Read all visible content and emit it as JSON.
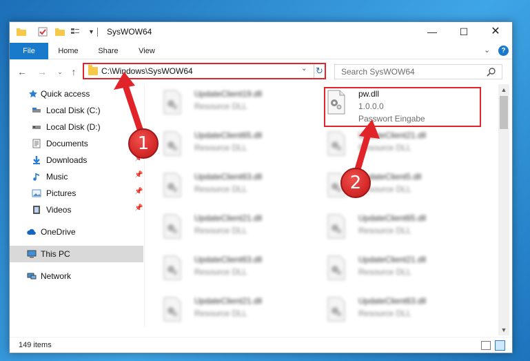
{
  "window": {
    "title": "SysWOW64"
  },
  "ribbon": {
    "tabs": [
      {
        "label": "File"
      },
      {
        "label": "Home"
      },
      {
        "label": "Share"
      },
      {
        "label": "View"
      }
    ]
  },
  "address_bar": {
    "path": "C:\\Windows\\SysWOW64"
  },
  "search": {
    "placeholder": "Search SysWOW64"
  },
  "nav_pane": {
    "items": [
      {
        "label": "Quick access",
        "icon": "star-icon"
      },
      {
        "label": "Local Disk (C:)",
        "icon": "drive-icon"
      },
      {
        "label": "Local Disk (D:)",
        "icon": "drive-icon"
      },
      {
        "label": "Documents",
        "icon": "documents-icon"
      },
      {
        "label": "Downloads",
        "icon": "download-icon"
      },
      {
        "label": "Music",
        "icon": "music-icon"
      },
      {
        "label": "Pictures",
        "icon": "pictures-icon"
      },
      {
        "label": "Videos",
        "icon": "videos-icon"
      },
      {
        "label": "OneDrive",
        "icon": "cloud-icon"
      },
      {
        "label": "This PC",
        "icon": "computer-icon"
      },
      {
        "label": "Network",
        "icon": "network-icon"
      }
    ]
  },
  "files": {
    "highlighted": {
      "name": "pw.dll",
      "version": "1.0.0.0",
      "description": "Passwort Eingabe"
    },
    "left_column": [
      {
        "name": "UpdateClient19.dll",
        "type": "Resource DLL"
      },
      {
        "name": "UpdateClient65.dll",
        "type": "Resource DLL"
      },
      {
        "name": "UpdateClient63.dll",
        "type": "Resource DLL"
      },
      {
        "name": "UpdateClient21.dll",
        "type": "Resource DLL"
      },
      {
        "name": "UpdateClient63.dll",
        "type": "Resource DLL"
      },
      {
        "name": "UpdateClient21.dll",
        "type": "Resource DLL"
      }
    ],
    "right_column": [
      {
        "name": "UpdateClient21.dll",
        "type": "Resource DLL"
      },
      {
        "name": "UpdateClient5.dll",
        "type": "Resource DLL"
      },
      {
        "name": "UpdateClient65.dll",
        "type": "Resource DLL"
      },
      {
        "name": "UpdateClient21.dll",
        "type": "Resource DLL"
      },
      {
        "name": "UpdateClient63.dll",
        "type": "Resource DLL"
      }
    ]
  },
  "status_bar": {
    "item_count": "149 items"
  },
  "annotations": {
    "step1": "1",
    "step2": "2",
    "color": "#e0242a"
  },
  "colors": {
    "accent": "#1979ca",
    "highlight": "#e0242a",
    "selected_bg": "#cde8ff"
  }
}
